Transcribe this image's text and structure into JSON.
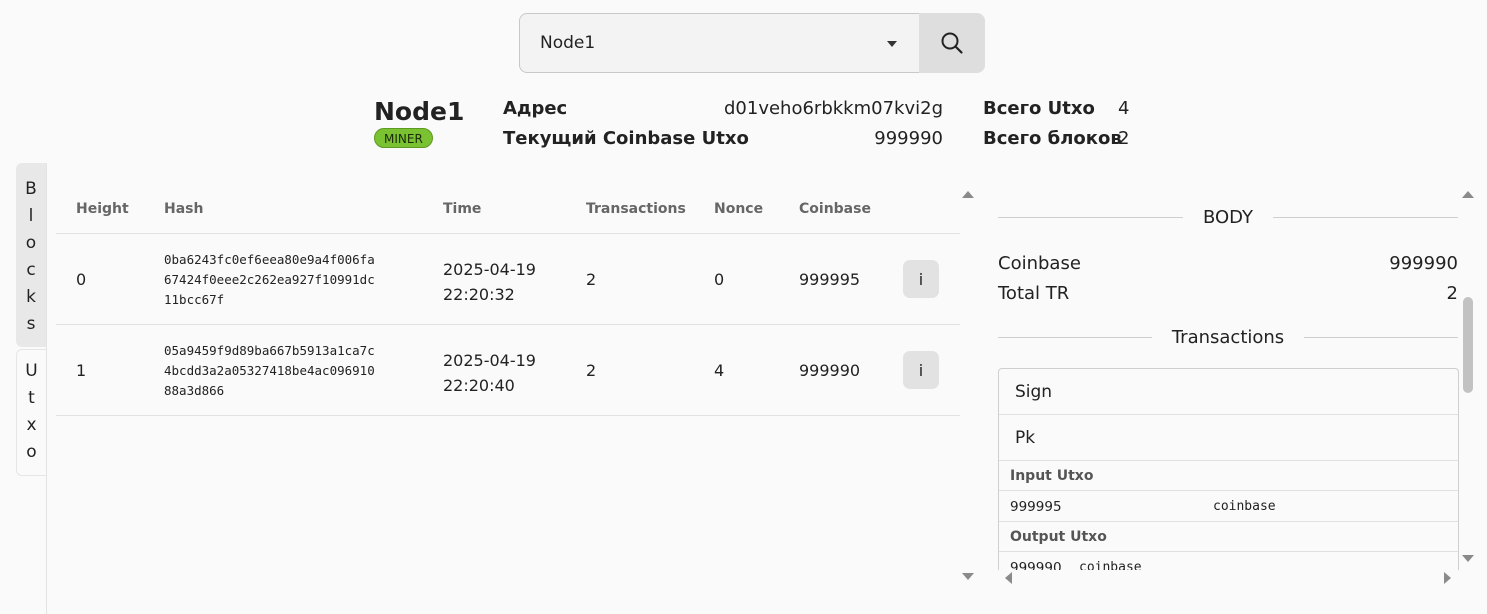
{
  "search": {
    "selected": "Node1"
  },
  "node": {
    "name": "Node1",
    "role_badge": "MINER",
    "address_label": "Адрес",
    "address_value": "d01veho6rbkkm07kvi2g",
    "coinbase_label": "Текущий Coinbase Utxo",
    "coinbase_value": "999990",
    "total_utxo_label": "Всего Utxo",
    "total_utxo_value": "4",
    "total_blocks_label": "Всего блоков",
    "total_blocks_value": "2"
  },
  "tabs": [
    "Blocks",
    "Utxo"
  ],
  "table": {
    "headers": [
      "Height",
      "Hash",
      "Time",
      "Transactions",
      "Nonce",
      "Coinbase"
    ],
    "rows": [
      {
        "height": "0",
        "hash_lines": [
          "0ba6243fc0ef6eea80e9a4f006fa",
          "67424f0eee2c262ea927f10991dc",
          "11bcc67f"
        ],
        "time_lines": [
          "2025-04-19",
          "22:20:32"
        ],
        "transactions": "2",
        "nonce": "0",
        "coinbase": "999995",
        "info": "i"
      },
      {
        "height": "1",
        "hash_lines": [
          "05a9459f9d89ba667b5913a1ca7c",
          "4bcdd3a2a05327418be4ac096910",
          "88a3d866"
        ],
        "time_lines": [
          "2025-04-19",
          "22:20:40"
        ],
        "transactions": "2",
        "nonce": "4",
        "coinbase": "999990",
        "info": "i"
      }
    ]
  },
  "detail": {
    "body_title": "BODY",
    "coinbase_label": "Coinbase",
    "coinbase_value": "999990",
    "total_tr_label": "Total TR",
    "total_tr_value": "2",
    "transactions_title": "Transactions",
    "sign_label": "Sign",
    "pk_label": "Pk",
    "input_utxo_label": "Input Utxo",
    "input_utxo": {
      "amount": "999995",
      "address": "coinbase"
    },
    "output_utxo_label": "Output Utxo",
    "output_utxo": {
      "amount": "999990",
      "address": "coinbase"
    }
  },
  "colors": {
    "badge": "#7ac232",
    "button": "#e2e2e2"
  }
}
